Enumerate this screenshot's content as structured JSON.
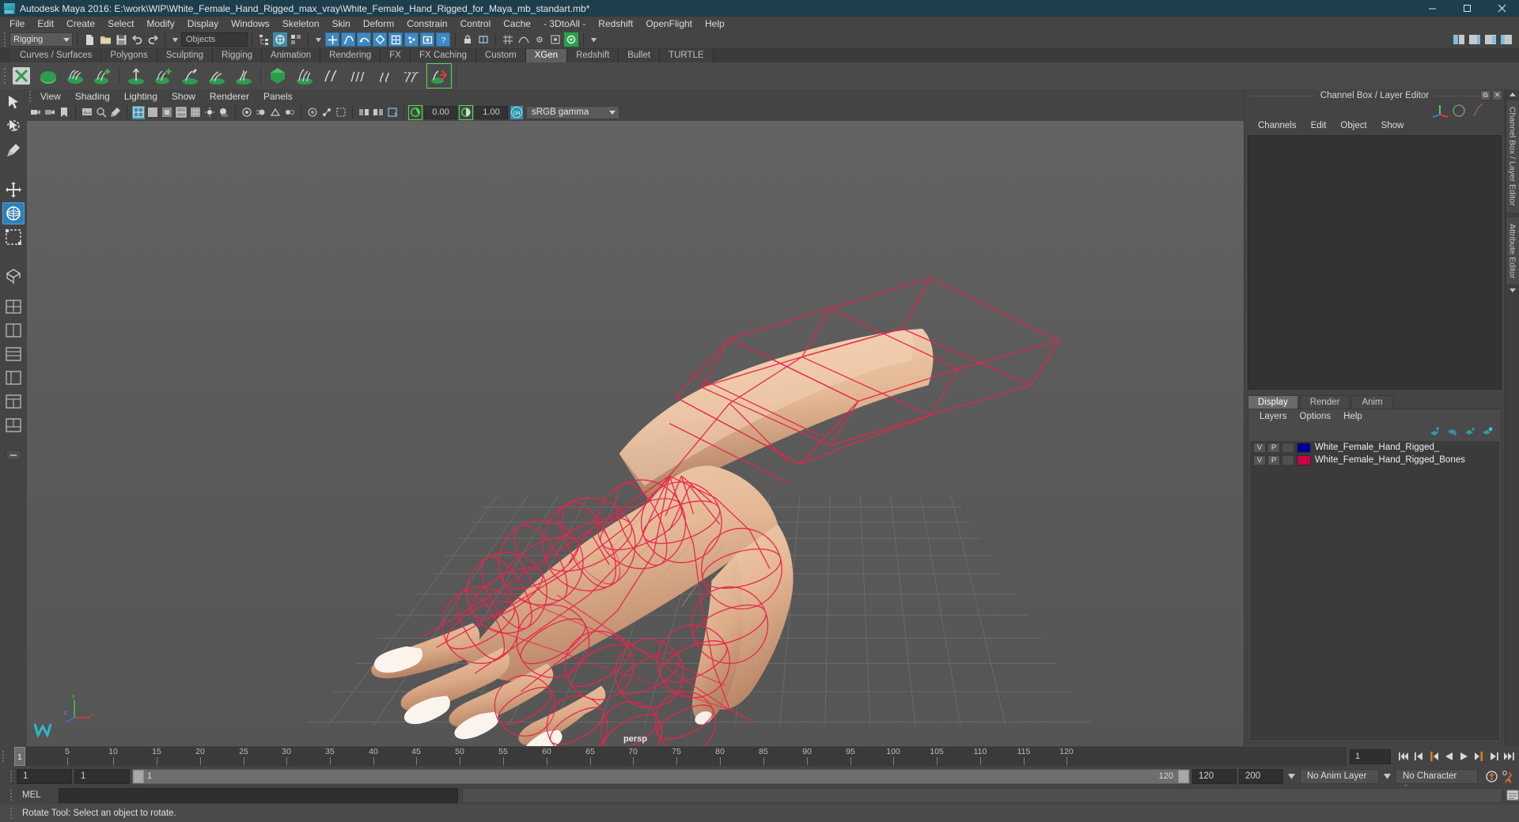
{
  "window": {
    "title": "Autodesk Maya 2016: E:\\work\\WIP\\White_Female_Hand_Rigged_max_vray\\White_Female_Hand_Rigged_for_Maya_mb_standart.mb*",
    "logo_icon": "maya-logo-icon",
    "minimize_icon": "minimize-icon",
    "maximize_icon": "maximize-icon",
    "close_icon": "close-icon"
  },
  "menubar": {
    "items": [
      "File",
      "Edit",
      "Create",
      "Select",
      "Modify",
      "Display",
      "Windows",
      "Skeleton",
      "Skin",
      "Deform",
      "Constrain",
      "Control",
      "Cache",
      "- 3DtoAll -",
      "Redshift",
      "OpenFlight",
      "Help"
    ]
  },
  "statusline": {
    "menu_set": "Rigging",
    "object_field": "Objects"
  },
  "shelf": {
    "tabs": [
      {
        "label": "Curves / Surfaces",
        "active": false
      },
      {
        "label": "Polygons",
        "active": false
      },
      {
        "label": "Sculpting",
        "active": false
      },
      {
        "label": "Rigging",
        "active": false
      },
      {
        "label": "Animation",
        "active": false
      },
      {
        "label": "Rendering",
        "active": false
      },
      {
        "label": "FX",
        "active": false
      },
      {
        "label": "FX Caching",
        "active": false
      },
      {
        "label": "Custom",
        "active": false
      },
      {
        "label": "XGen",
        "active": true
      },
      {
        "label": "Redshift",
        "active": false
      },
      {
        "label": "Bullet",
        "active": false
      },
      {
        "label": "TURTLE",
        "active": false
      }
    ]
  },
  "viewport": {
    "menu": [
      "View",
      "Shading",
      "Lighting",
      "Show",
      "Renderer",
      "Panels"
    ],
    "exposure_value": "0.00",
    "gamma_value": "1.00",
    "color_management": "sRGB gamma",
    "camera_label": "persp"
  },
  "right_panel": {
    "title": "Channel Box / Layer Editor",
    "restore_icon": "restore-panel-icon",
    "close_icon": "close-panel-icon",
    "channel_menu": [
      "Channels",
      "Edit",
      "Object",
      "Show"
    ],
    "layer_tabs": [
      {
        "label": "Display",
        "active": true
      },
      {
        "label": "Render",
        "active": false
      },
      {
        "label": "Anim",
        "active": false
      }
    ],
    "layer_menu": [
      "Layers",
      "Options",
      "Help"
    ],
    "layer_tool_icons": [
      "move-layer-up-icon",
      "move-layer-down-icon",
      "new-layer-icon",
      "new-layer-from-selected-icon"
    ],
    "layers": [
      {
        "visibility": "V",
        "playback": "P",
        "type": "",
        "color": "#00008f",
        "name": "White_Female_Hand_Rigged_"
      },
      {
        "visibility": "V",
        "playback": "P",
        "type": "",
        "color": "#cc0044",
        "name": "White_Female_Hand_Rigged_Bones"
      }
    ],
    "vertical_tabs": [
      "Channel Box / Layer Editor",
      "Attribute Editor"
    ]
  },
  "timeslider": {
    "current_frame": "1",
    "ticks": [
      5,
      10,
      15,
      20,
      25,
      30,
      35,
      40,
      45,
      50,
      55,
      60,
      65,
      70,
      75,
      80,
      85,
      90,
      95,
      100,
      105,
      110,
      115,
      120
    ],
    "end_label": "120",
    "frame_field": "1",
    "playback_icons": [
      "go-to-start-icon",
      "step-back-keyframe-icon",
      "step-back-frame-icon",
      "play-backwards-icon",
      "play-forwards-icon",
      "step-forward-frame-icon",
      "step-forward-keyframe-icon",
      "go-to-end-icon"
    ]
  },
  "rangeslider": {
    "anim_start": "1",
    "range_start": "1",
    "bar_left_label": "1",
    "bar_right_label": "120",
    "range_end": "120",
    "anim_end": "200",
    "anim_layer": "No Anim Layer",
    "character_set": "No Character Set",
    "auto_key_icon": "auto-keyframe-icon",
    "anim_prefs_icon": "animation-preferences-icon"
  },
  "command_line": {
    "language_label": "MEL",
    "input_value": "",
    "output_value": ""
  },
  "helpline": {
    "text": "Rotate Tool: Select an object to rotate."
  },
  "toolbox": {
    "items": [
      {
        "icon": "select-tool-icon",
        "active": false
      },
      {
        "icon": "lasso-select-tool-icon",
        "active": false
      },
      {
        "icon": "paint-select-tool-icon",
        "active": false
      },
      {
        "icon": "move-tool-icon",
        "active": false
      },
      {
        "icon": "rotate-tool-icon",
        "active": true
      },
      {
        "icon": "scale-tool-icon",
        "active": false
      },
      {
        "icon": "last-tool-icon",
        "active": false
      }
    ]
  },
  "colors": {
    "titlebar": "#1d3e4d",
    "chrome": "#444444",
    "viewport_bg": "#5c5c5c",
    "accent_blue": "#3f89c4",
    "rig_curve_red": "#e03050",
    "skin": "#e8bd9a"
  }
}
